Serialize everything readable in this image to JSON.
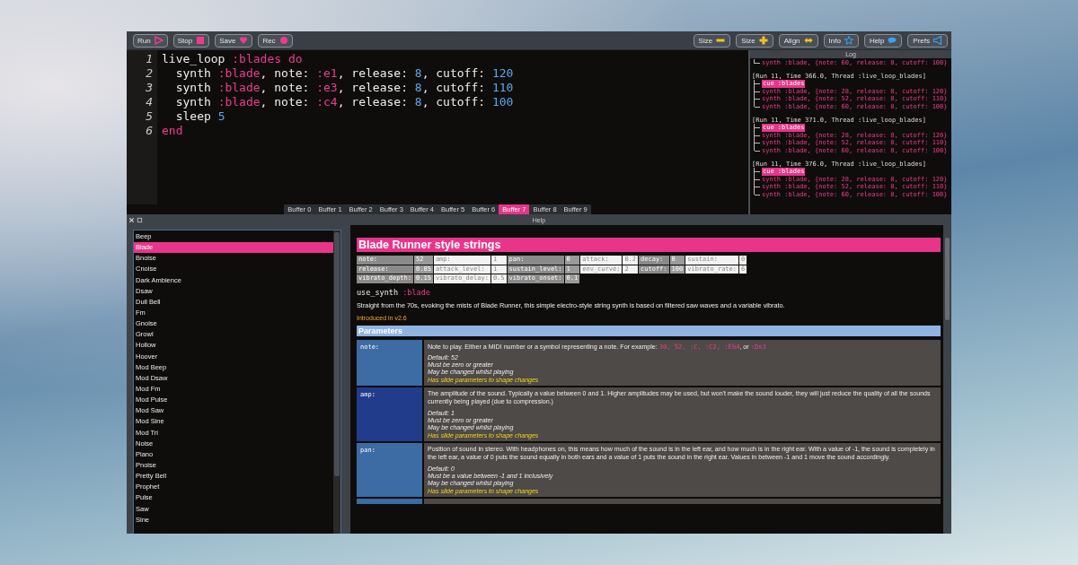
{
  "toolbar": {
    "left": [
      "Run",
      "Stop",
      "Save",
      "Rec"
    ],
    "right": [
      "Size",
      "Size",
      "Align",
      "Info",
      "Help",
      "Prefs"
    ]
  },
  "editor": {
    "lines": [
      [
        {
          "t": "live_loop ",
          "kind": "plain"
        },
        {
          "t": ":blades",
          "kind": "symbol"
        },
        {
          "t": " do",
          "kind": "keyword"
        }
      ],
      [
        {
          "t": "  synth ",
          "kind": "plain"
        },
        {
          "t": ":blade",
          "kind": "symbol"
        },
        {
          "t": ", note: ",
          "kind": "plain"
        },
        {
          "t": ":e1",
          "kind": "symbol"
        },
        {
          "t": ", release: ",
          "kind": "plain"
        },
        {
          "t": "8",
          "kind": "number"
        },
        {
          "t": ", cutoff: ",
          "kind": "plain"
        },
        {
          "t": "120",
          "kind": "number"
        }
      ],
      [
        {
          "t": "  synth ",
          "kind": "plain"
        },
        {
          "t": ":blade",
          "kind": "symbol"
        },
        {
          "t": ", note: ",
          "kind": "plain"
        },
        {
          "t": ":e3",
          "kind": "symbol"
        },
        {
          "t": ", release: ",
          "kind": "plain"
        },
        {
          "t": "8",
          "kind": "number"
        },
        {
          "t": ", cutoff: ",
          "kind": "plain"
        },
        {
          "t": "110",
          "kind": "number"
        }
      ],
      [
        {
          "t": "  synth ",
          "kind": "plain"
        },
        {
          "t": ":blade",
          "kind": "symbol"
        },
        {
          "t": ", note: ",
          "kind": "plain"
        },
        {
          "t": ":c4",
          "kind": "symbol"
        },
        {
          "t": ", release: ",
          "kind": "plain"
        },
        {
          "t": "8",
          "kind": "number"
        },
        {
          "t": ", cutoff: ",
          "kind": "plain"
        },
        {
          "t": "100",
          "kind": "number"
        }
      ],
      [
        {
          "t": "  sleep ",
          "kind": "plain"
        },
        {
          "t": "5",
          "kind": "number"
        }
      ],
      [
        {
          "t": "end",
          "kind": "keyword"
        }
      ]
    ],
    "line_numbers": [
      "1",
      "2",
      "3",
      "4",
      "5",
      "6"
    ]
  },
  "buffers": [
    {
      "label": "Buffer 0",
      "selected": false
    },
    {
      "label": "Buffer 1",
      "selected": false
    },
    {
      "label": "Buffer 2",
      "selected": false
    },
    {
      "label": "Buffer 3",
      "selected": false
    },
    {
      "label": "Buffer 4",
      "selected": false
    },
    {
      "label": "Buffer 5",
      "selected": false
    },
    {
      "label": "Buffer 6",
      "selected": false
    },
    {
      "label": "Buffer 7",
      "selected": true
    },
    {
      "label": "Buffer 8",
      "selected": false
    },
    {
      "label": "Buffer 9",
      "selected": false
    }
  ],
  "log": {
    "title": "Log",
    "blocks": [
      {
        "lines": [
          {
            "t": "synth :blade, {note: 60, release: 8, cutoff: 100}",
            "kind": "synth"
          }
        ]
      },
      {
        "header": "[Run 11, Time 366.0, Thread :live_loop_blades]",
        "lines": [
          {
            "t": "cue :blades",
            "kind": "cue"
          },
          {
            "t": "synth :blade, {note: 28, release: 8, cutoff: 120}",
            "kind": "synth"
          },
          {
            "t": "synth :blade, {note: 52, release: 8, cutoff: 110}",
            "kind": "synth"
          },
          {
            "t": "synth :blade, {note: 60, release: 8, cutoff: 100}",
            "kind": "synth"
          }
        ]
      },
      {
        "header": "[Run 11, Time 371.0, Thread :live_loop_blades]",
        "lines": [
          {
            "t": "cue :blades",
            "kind": "cue"
          },
          {
            "t": "synth :blade, {note: 28, release: 8, cutoff: 120}",
            "kind": "synth"
          },
          {
            "t": "synth :blade, {note: 52, release: 8, cutoff: 110}",
            "kind": "synth"
          },
          {
            "t": "synth :blade, {note: 60, release: 8, cutoff: 100}",
            "kind": "synth"
          }
        ]
      },
      {
        "header": "[Run 11, Time 376.0, Thread :live_loop_blades]",
        "lines": [
          {
            "t": "cue :blades",
            "kind": "cue"
          },
          {
            "t": "synth :blade, {note: 28, release: 8, cutoff: 120}",
            "kind": "synth"
          },
          {
            "t": "synth :blade, {note: 52, release: 8, cutoff: 110}",
            "kind": "synth"
          },
          {
            "t": "synth :blade, {note: 60, release: 8, cutoff: 100}",
            "kind": "synth"
          }
        ]
      }
    ]
  },
  "help_bar": {
    "title": "Help"
  },
  "synths": [
    {
      "label": "Beep",
      "selected": false
    },
    {
      "label": "Blade",
      "selected": true
    },
    {
      "label": "Bnoise",
      "selected": false
    },
    {
      "label": "Cnoise",
      "selected": false
    },
    {
      "label": "Dark Ambience",
      "selected": false
    },
    {
      "label": "Dsaw",
      "selected": false
    },
    {
      "label": "Dull Bell",
      "selected": false
    },
    {
      "label": "Fm",
      "selected": false
    },
    {
      "label": "Gnoise",
      "selected": false
    },
    {
      "label": "Growl",
      "selected": false
    },
    {
      "label": "Hollow",
      "selected": false
    },
    {
      "label": "Hoover",
      "selected": false
    },
    {
      "label": "Mod Beep",
      "selected": false
    },
    {
      "label": "Mod Dsaw",
      "selected": false
    },
    {
      "label": "Mod Fm",
      "selected": false
    },
    {
      "label": "Mod Pulse",
      "selected": false
    },
    {
      "label": "Mod Saw",
      "selected": false
    },
    {
      "label": "Mod Sine",
      "selected": false
    },
    {
      "label": "Mod Tri",
      "selected": false
    },
    {
      "label": "Noise",
      "selected": false
    },
    {
      "label": "Piano",
      "selected": false
    },
    {
      "label": "Pnoise",
      "selected": false
    },
    {
      "label": "Pretty Bell",
      "selected": false
    },
    {
      "label": "Prophet",
      "selected": false
    },
    {
      "label": "Pulse",
      "selected": false
    },
    {
      "label": "Saw",
      "selected": false
    },
    {
      "label": "Sine",
      "selected": false
    }
  ],
  "help": {
    "title": "Blade Runner style strings",
    "defaults": [
      [
        [
          "note:",
          "52"
        ],
        [
          "amp:",
          "1"
        ],
        [
          "pan:",
          "0"
        ],
        [
          "attack:",
          "0.2"
        ],
        [
          "decay:",
          "0"
        ],
        [
          "sustain:",
          "0"
        ]
      ],
      [
        [
          "release:",
          "0.85"
        ],
        [
          "attack_level:",
          "1"
        ],
        [
          "sustain_level:",
          "1"
        ],
        [
          "env_curve:",
          "2"
        ],
        [
          "cutoff:",
          "100"
        ],
        [
          "vibrato_rate:",
          "6"
        ]
      ],
      [
        [
          "vibrato_depth:",
          "0.15"
        ],
        [
          "vibrato_delay:",
          "0.5"
        ],
        [
          "vibrato_onset:",
          "0.1"
        ]
      ]
    ],
    "usage": {
      "fn": "use_synth",
      "arg": ":blade"
    },
    "summary": "Straight from the 70s, evoking the mists of Blade Runner, this simple electro-style string synth is based on filtered saw waves and a variable vibrato.",
    "introduced": "Introduced in v2.6",
    "parameters_heading": "Parameters",
    "parameters": [
      {
        "name": "note:",
        "desc": [
          {
            "t": "Note to play. Either a MIDI number or a symbol representing a note. For example: ",
            "code": false
          },
          {
            "t": "30, 52, :C, :C2, :Eb4",
            "code": true
          },
          {
            "t": ", or ",
            "code": false
          },
          {
            "t": ":Ds3",
            "code": true
          }
        ],
        "notes": [
          {
            "t": "Default: 52",
            "kind": "plain"
          },
          {
            "t": "Must be zero or greater",
            "kind": "plain"
          },
          {
            "t": "May be changed whilst playing",
            "kind": "plain"
          },
          {
            "t": "Has slide parameters to shape changes",
            "kind": "slide"
          }
        ]
      },
      {
        "name": "amp:",
        "desc": [
          {
            "t": "The amplitude of the sound. Typically a value between 0 and 1. Higher amplitudes may be used, but won't make the sound louder, they will just reduce the quality of all the sounds currently being played (due to compression.)",
            "code": false
          }
        ],
        "notes": [
          {
            "t": "Default: 1",
            "kind": "plain"
          },
          {
            "t": "Must be zero or greater",
            "kind": "plain"
          },
          {
            "t": "May be changed whilst playing",
            "kind": "plain"
          },
          {
            "t": "Has slide parameters to shape changes",
            "kind": "slide"
          }
        ]
      },
      {
        "name": "pan:",
        "desc": [
          {
            "t": "Position of sound in stereo. With headphones on, this means how much of the sound is in the left ear, and how much is in the right ear. With a value of -1, the sound is completely in the left ear, a value of 0 puts the sound equally in both ears and a value of 1 puts the sound in the right ear. Values in between -1 and 1 move the sound accordingly.",
            "code": false
          }
        ],
        "notes": [
          {
            "t": "Default: 0",
            "kind": "plain"
          },
          {
            "t": "Must be a value between -1 and 1 inclusively",
            "kind": "plain"
          },
          {
            "t": "May be changed whilst playing",
            "kind": "plain"
          },
          {
            "t": "Has slide parameters to shape changes",
            "kind": "slide"
          }
        ]
      }
    ]
  }
}
